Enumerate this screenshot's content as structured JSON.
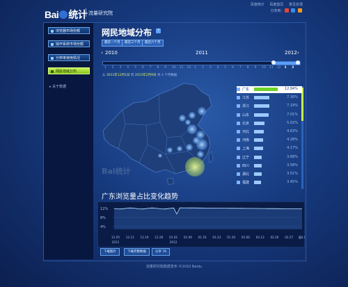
{
  "header": {
    "logo_text_a": "Bai",
    "logo_text_b": "统计",
    "logo_sub": "流量研究院",
    "top_links": [
      "百度统计",
      "百度首页",
      "意见反馈"
    ],
    "share_label": "分享到:"
  },
  "sidebar": {
    "items": [
      {
        "label": "浏览器市场份额"
      },
      {
        "label": "操作系统市场份额"
      },
      {
        "label": "分辨率使用情况"
      },
      {
        "label": "网民地域分布",
        "active": true
      }
    ],
    "about": "关于数据"
  },
  "main": {
    "title": "网民地域分布",
    "help": "?",
    "ranges": [
      "最近一个月",
      "最近三个月",
      "最近六个月"
    ]
  },
  "timeline": {
    "years": [
      "2010",
      "2011",
      "2012"
    ],
    "ticks": [
      "1",
      "2",
      "3",
      "4",
      "5",
      "6",
      "7",
      "8",
      "9",
      "10",
      "11",
      "12",
      "1",
      "2",
      "3",
      "4",
      "5",
      "6",
      "7",
      "8",
      "9",
      "10",
      "11",
      "12",
      "1",
      "2"
    ],
    "selected": [
      24,
      25
    ],
    "prev": "‹",
    "next": "›"
  },
  "date_info": {
    "prefix": "从",
    "start": "2011年12月1日",
    "mid": "到",
    "end": "2012年2月9日",
    "suffix": "共 3 个月数据"
  },
  "watermark": "Bai统计",
  "ranking": [
    {
      "name": "广东",
      "pct": "12.84%",
      "value": 12.84
    },
    {
      "name": "江苏",
      "pct": "7.30%",
      "value": 7.3
    },
    {
      "name": "浙江",
      "pct": "7.19%",
      "value": 7.19
    },
    {
      "name": "山东",
      "pct": "7.01%",
      "value": 7.01
    },
    {
      "name": "北京",
      "pct": "5.02%",
      "value": 5.02
    },
    {
      "name": "河北",
      "pct": "4.63%",
      "value": 4.63
    },
    {
      "name": "河南",
      "pct": "4.28%",
      "value": 4.28
    },
    {
      "name": "上海",
      "pct": "4.17%",
      "value": 4.17
    },
    {
      "name": "辽宁",
      "pct": "3.68%",
      "value": 3.68
    },
    {
      "name": "四川",
      "pct": "3.58%",
      "value": 3.58
    },
    {
      "name": "湖北",
      "pct": "3.51%",
      "value": 3.51
    },
    {
      "name": "福建",
      "pct": "3.45%",
      "value": 3.45
    }
  ],
  "trend": {
    "title": "广东浏览量占比变化趋势",
    "yticks": [
      "12%",
      "8%",
      "4%"
    ],
    "xticks": [
      "12.05",
      "12.12",
      "12.19",
      "12.26",
      "01.02",
      "01.09",
      "01.16",
      "01.23",
      "01.30",
      "02.06",
      "02.13",
      "02.20",
      "02.27",
      "03.05"
    ],
    "year_labels": [
      "2011",
      "2012"
    ],
    "end_label": "日",
    "buttons": [
      "下载图片",
      "下载完整数据",
      "分享 76"
    ]
  },
  "footer": "流量研究院数据发布 ©2010 Baidu",
  "colors": {
    "accent": "#c8f04a",
    "panel": "#0c1f4f",
    "bar": "#9ccaff"
  }
}
